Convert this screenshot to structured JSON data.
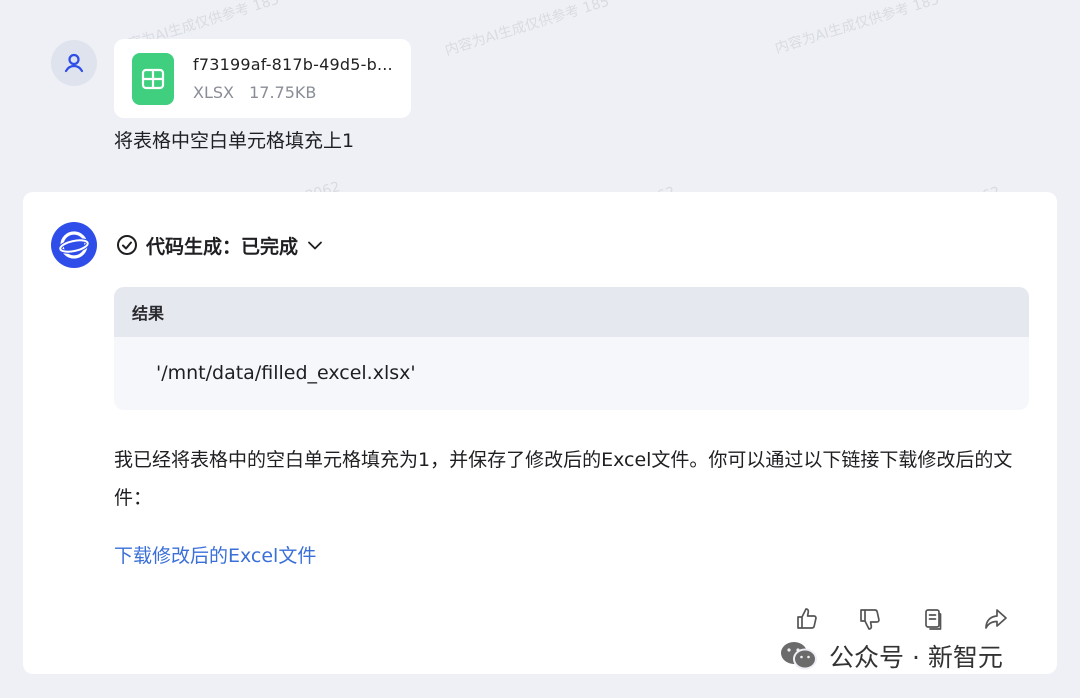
{
  "user_message": {
    "attachment": {
      "file_name": "f73199af-817b-49d5-b...",
      "file_type": "XLSX",
      "file_size": "17.75KB",
      "icon": "spreadsheet-icon"
    },
    "text": "将表格中空白单元格填充上1"
  },
  "assistant_message": {
    "status": "代码生成：已完成",
    "result": {
      "header": "结果",
      "value": "'/mnt/data/filled_excel.xlsx'"
    },
    "answer": "我已经将表格中的空白单元格填充为1，并保存了修改后的Excel文件。你可以通过以下链接下载修改后的文件：",
    "download_link": "下载修改后的Excel文件",
    "actions": [
      "thumbs-up-icon",
      "thumbs-down-icon",
      "copy-icon",
      "share-icon"
    ]
  },
  "watermark": {
    "brand": "公众号 · 新智元",
    "faint_text": "内容为AI生成仅供参考",
    "faint_phone": "185****8062"
  },
  "colors": {
    "background": "#eef0f5",
    "link": "#3a6fd8",
    "xlsx_icon": "#3fcf7f",
    "bot_avatar": "#2f4de8"
  }
}
